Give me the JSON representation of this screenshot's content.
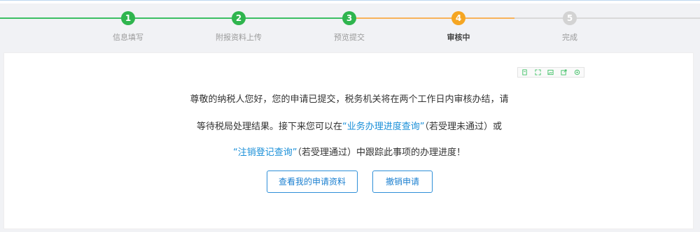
{
  "steps": [
    {
      "number": "1",
      "label": "信息填写",
      "status": "done"
    },
    {
      "number": "2",
      "label": "附报资料上传",
      "status": "done"
    },
    {
      "number": "3",
      "label": "预览提交",
      "status": "done"
    },
    {
      "number": "4",
      "label": "审核中",
      "status": "active"
    },
    {
      "number": "5",
      "label": "完成",
      "status": "todo"
    }
  ],
  "message": {
    "line1": "尊敬的纳税人您好，您的申请已提交，税务机关将在两个工作日内审核办结，请",
    "line2_prefix": "等待税局处理结果。接下来您可以在",
    "line2_link": "“业务办理进度查询”",
    "line2_suffix": "（若受理未通过）或",
    "line3_link": "“注销登记查询”",
    "line3_suffix": "（若受理通过）中跟踪此事项的办理进度！"
  },
  "buttons": {
    "view_materials": "查看我的申请资料",
    "revoke": "撤销申请"
  },
  "colors": {
    "done": "#2fb54e",
    "active": "#f5a623",
    "todo": "#d3d3d3",
    "link": "#1a8fd8",
    "button_border": "#2f8fd8"
  },
  "toolbar_icons": [
    "document-icon",
    "expand-icon",
    "image-icon",
    "export-icon",
    "settings-icon"
  ]
}
